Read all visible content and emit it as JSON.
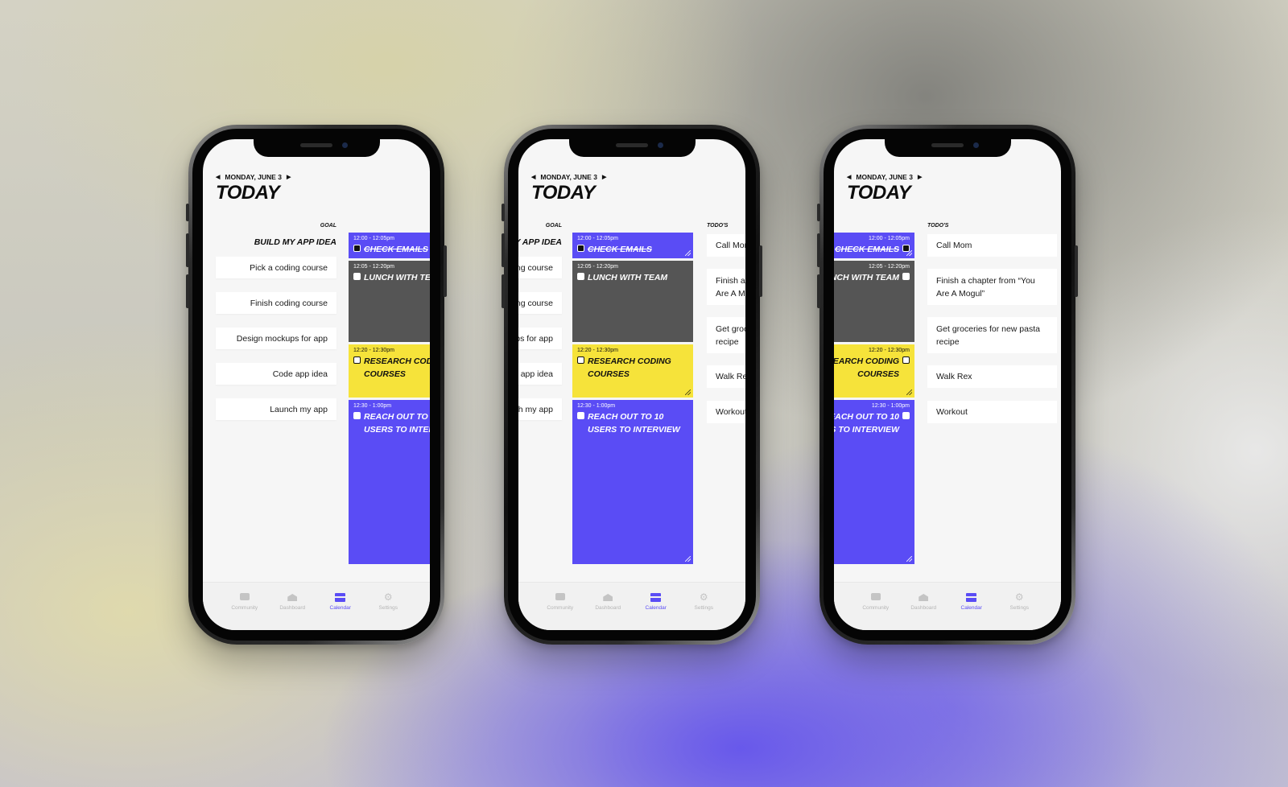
{
  "screen": {
    "date": "MONDAY, JUNE 3",
    "title": "TODAY"
  },
  "goal": {
    "label": "GOAL",
    "title": "BUILD MY APP IDEA",
    "items": [
      "Pick a coding course",
      "Finish coding course",
      "Design mockups for app",
      "Code app idea",
      "Launch my app"
    ]
  },
  "events": [
    {
      "time": "12:00 - 12:05pm",
      "title": "CHECK EMAILS",
      "done": true,
      "color": "#5a4cf5"
    },
    {
      "time": "12:05 - 12:20pm",
      "title": "LUNCH WITH TEAM",
      "done": false,
      "color": "#555555"
    },
    {
      "time": "12:20 - 12:30pm",
      "title": "RESEARCH CODING COURSES",
      "done": false,
      "color": "#f6e33a"
    },
    {
      "time": "12:30 - 1:00pm",
      "title": "REACH OUT TO 10 USERS TO INTERVIEW",
      "done": false,
      "color": "#5a4cf5"
    }
  ],
  "todos": {
    "label": "TODO'S",
    "items": [
      "Call Mom",
      "Finish a chapter from “You Are A Mogul”",
      "Get groceries for new pasta recipe",
      "Walk Rex",
      "Workout"
    ]
  },
  "tabbar": {
    "items": [
      {
        "label": "Community",
        "icon": "chat-icon"
      },
      {
        "label": "Dashboard",
        "icon": "home-icon"
      },
      {
        "label": "Calendar",
        "icon": "calendar-icon",
        "active": true
      },
      {
        "label": "Settings",
        "icon": "gear-icon"
      }
    ]
  },
  "colors": {
    "accent": "#5a4cf5",
    "event_gray": "#555555",
    "event_yellow": "#f6e33a"
  }
}
